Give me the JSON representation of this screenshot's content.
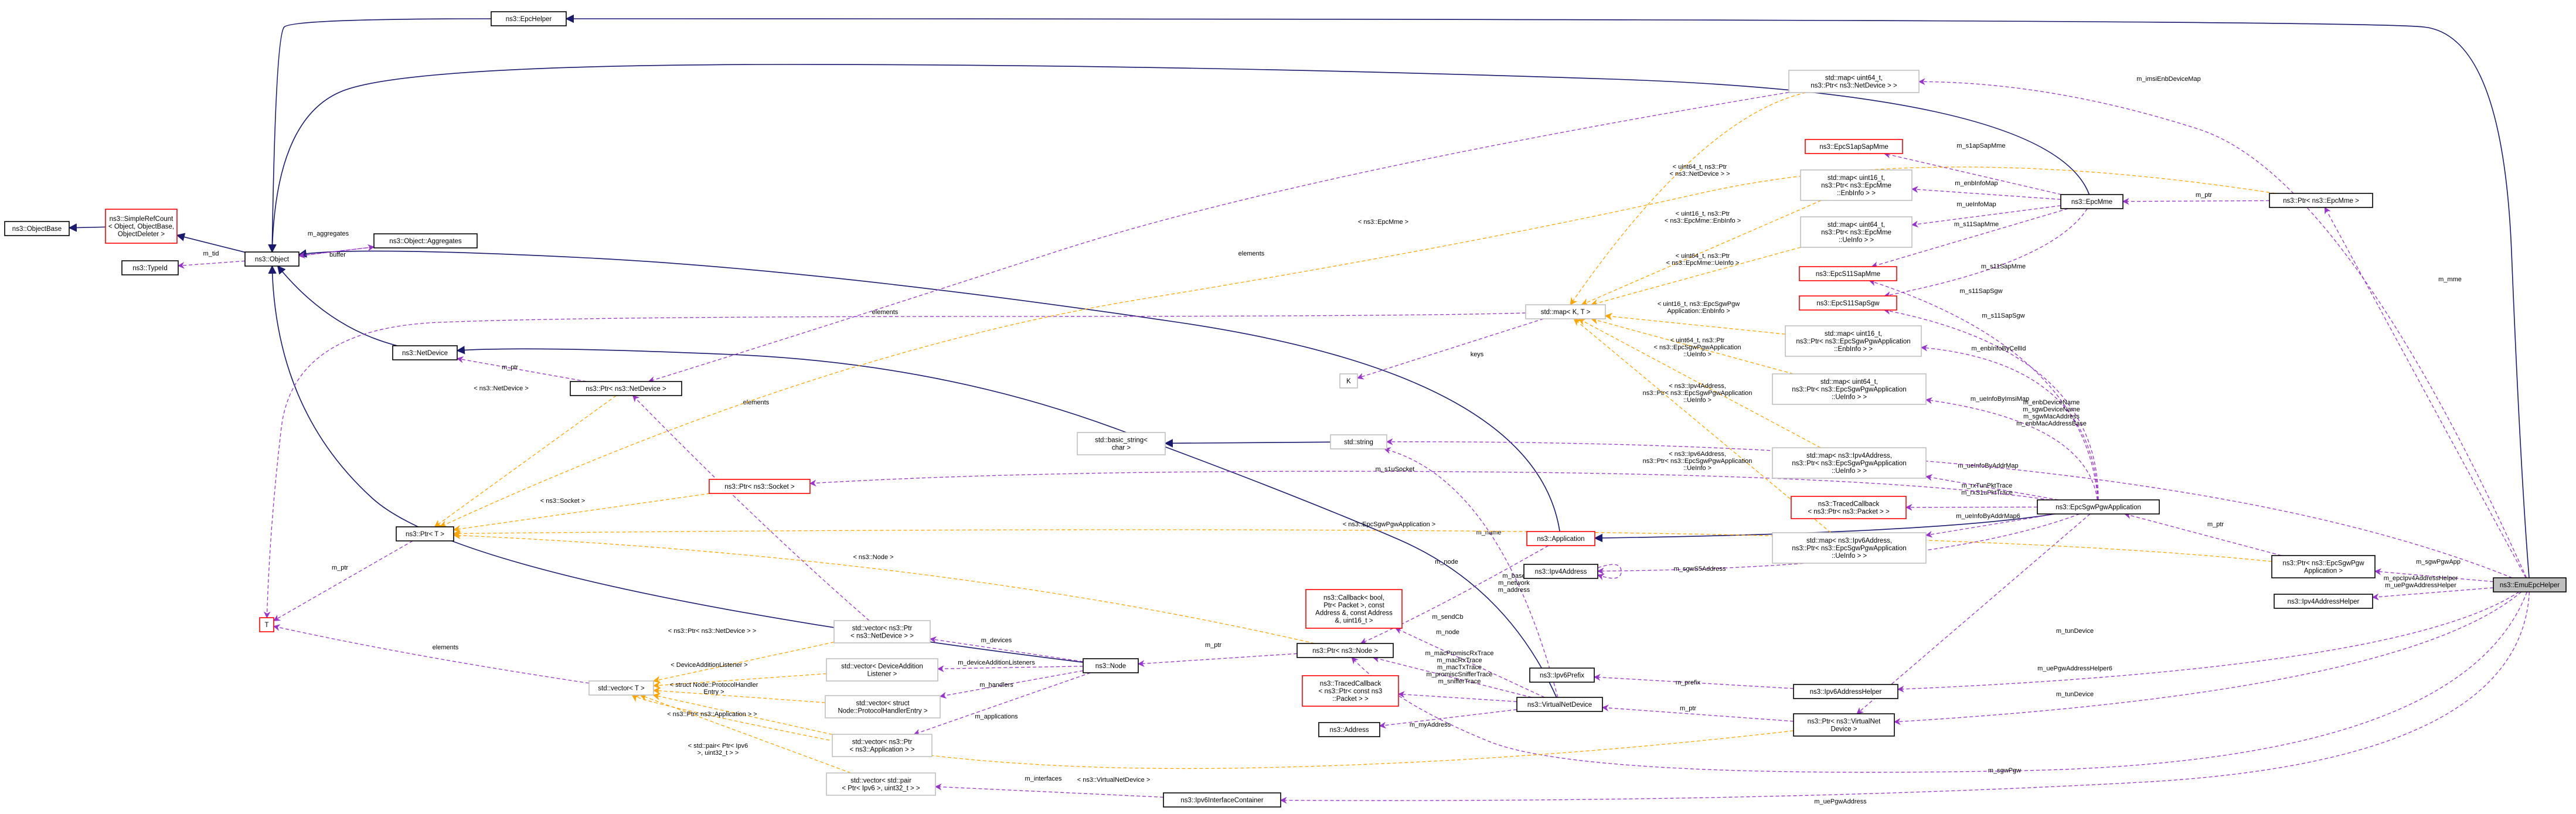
{
  "colors": {
    "inherit": "#191970",
    "use": "#9a32cd",
    "template": "#ffa500",
    "default_border": "#000000",
    "gray_border": "#bfbfbf",
    "red_border": "#ff0000",
    "highlight_fill": "#bfbfbf"
  },
  "nodes": [
    {
      "id": "EpcHelper",
      "lines": [
        "ns3::EpcHelper"
      ],
      "border": "black"
    },
    {
      "id": "ObjectBase",
      "lines": [
        "ns3::ObjectBase"
      ],
      "border": "black"
    },
    {
      "id": "SimpleRefCount",
      "lines": [
        "ns3::SimpleRefCount",
        "< Object, ObjectBase,",
        "ObjectDeleter >"
      ],
      "border": "red"
    },
    {
      "id": "TypeId",
      "lines": [
        "ns3::TypeId"
      ],
      "border": "black"
    },
    {
      "id": "Object",
      "lines": [
        "ns3::Object"
      ],
      "border": "black"
    },
    {
      "id": "ObjectAggregates",
      "lines": [
        "ns3::Object::Aggregates"
      ],
      "border": "black"
    },
    {
      "id": "NetDevice",
      "lines": [
        "ns3::NetDevice"
      ],
      "border": "black"
    },
    {
      "id": "PtrNetDevice",
      "lines": [
        "ns3::Ptr< ns3::NetDevice >"
      ],
      "border": "black"
    },
    {
      "id": "PtrT",
      "lines": [
        "ns3::Ptr< T >"
      ],
      "border": "black"
    },
    {
      "id": "PtrSocket",
      "lines": [
        "ns3::Ptr< ns3::Socket >"
      ],
      "border": "red"
    },
    {
      "id": "T",
      "lines": [
        "T"
      ],
      "border": "red"
    },
    {
      "id": "BasicString",
      "lines": [
        "std::basic_string<",
        "char >"
      ],
      "border": "gray"
    },
    {
      "id": "String",
      "lines": [
        "std::string"
      ],
      "border": "gray"
    },
    {
      "id": "MapNetDevice",
      "lines": [
        "std::map< uint64_t,",
        "ns3::Ptr< ns3::NetDevice > >"
      ],
      "border": "gray"
    },
    {
      "id": "EpcS1apSapMme",
      "lines": [
        "ns3::EpcS1apSapMme"
      ],
      "border": "red"
    },
    {
      "id": "MapEnbInfo",
      "lines": [
        "std::map< uint16_t,",
        "ns3::Ptr< ns3::EpcMme",
        "::EnbInfo > >"
      ],
      "border": "gray"
    },
    {
      "id": "MapUeInfo",
      "lines": [
        "std::map< uint64_t,",
        "ns3::Ptr< ns3::EpcMme",
        "::UeInfo > >"
      ],
      "border": "gray"
    },
    {
      "id": "EpcS11SapMme",
      "lines": [
        "ns3::EpcS11SapMme"
      ],
      "border": "red"
    },
    {
      "id": "EpcS11SapSgw",
      "lines": [
        "ns3::EpcS11SapSgw"
      ],
      "border": "red"
    },
    {
      "id": "StdMapKT",
      "lines": [
        "std::map< K, T >"
      ],
      "border": "gray"
    },
    {
      "id": "K",
      "lines": [
        "K"
      ],
      "border": "gray"
    },
    {
      "id": "MapSgwEnb",
      "lines": [
        "std::map< uint16_t,",
        "ns3::Ptr< ns3::EpcSgwPgwApplication",
        "::EnbInfo > >"
      ],
      "border": "gray"
    },
    {
      "id": "MapSgwUe",
      "lines": [
        "std::map< uint64_t,",
        "ns3::Ptr< ns3::EpcSgwPgwApplication",
        "::UeInfo > >"
      ],
      "border": "gray"
    },
    {
      "id": "MapIpv4Ue",
      "lines": [
        "std::map< ns3::Ipv4Address,",
        "ns3::Ptr< ns3::EpcSgwPgwApplication",
        "::UeInfo > >"
      ],
      "border": "gray"
    },
    {
      "id": "TracedCallbackPacket",
      "lines": [
        "ns3::TracedCallback",
        "< ns3::Ptr< ns3::Packet > >"
      ],
      "border": "red"
    },
    {
      "id": "MapIpv6Ue",
      "lines": [
        "std::map< ns3::Ipv6Address,",
        "ns3::Ptr< ns3::EpcSgwPgwApplication",
        "::UeInfo > >"
      ],
      "border": "gray"
    },
    {
      "id": "EpcMme",
      "lines": [
        "ns3::EpcMme"
      ],
      "border": "black"
    },
    {
      "id": "PtrEpcMme",
      "lines": [
        "ns3::Ptr< ns3::EpcMme >"
      ],
      "border": "black"
    },
    {
      "id": "EpcSgwPgwApplication",
      "lines": [
        "ns3::EpcSgwPgwApplication"
      ],
      "border": "black"
    },
    {
      "id": "Application",
      "lines": [
        "ns3::Application"
      ],
      "border": "red"
    },
    {
      "id": "Ipv4Address",
      "lines": [
        "ns3::Ipv4Address"
      ],
      "border": "black"
    },
    {
      "id": "PtrEpcSgwPgwApp",
      "lines": [
        "ns3::Ptr< ns3::EpcSgwPgw",
        "Application >"
      ],
      "border": "black"
    },
    {
      "id": "Ipv4AddressHelper",
      "lines": [
        "ns3::Ipv4AddressHelper"
      ],
      "border": "black"
    },
    {
      "id": "EmuEpcHelper",
      "lines": [
        "ns3::EmuEpcHelper"
      ],
      "border": "black",
      "highlight": true
    },
    {
      "id": "CallbackBool",
      "lines": [
        "ns3::Callback< bool,",
        "Ptr< Packet >, const",
        "Address &, const Address",
        "&, uint16_t >"
      ],
      "border": "red"
    },
    {
      "id": "PtrNode",
      "lines": [
        "ns3::Ptr< ns3::Node >"
      ],
      "border": "black"
    },
    {
      "id": "TracedCallbackConstPacket",
      "lines": [
        "ns3::TracedCallback",
        "< ns3::Ptr< const ns3",
        "::Packet > >"
      ],
      "border": "red"
    },
    {
      "id": "Address",
      "lines": [
        "ns3::Address"
      ],
      "border": "black"
    },
    {
      "id": "Ipv6Prefix",
      "lines": [
        "ns3::Ipv6Prefix"
      ],
      "border": "black"
    },
    {
      "id": "VirtualNetDevice",
      "lines": [
        "ns3::VirtualNetDevice"
      ],
      "border": "black"
    },
    {
      "id": "Ipv6AddressHelper",
      "lines": [
        "ns3::Ipv6AddressHelper"
      ],
      "border": "black"
    },
    {
      "id": "PtrVirtualNetDevice",
      "lines": [
        "ns3::Ptr< ns3::VirtualNet",
        "Device >"
      ],
      "border": "black"
    },
    {
      "id": "VectorPtrNetDevice",
      "lines": [
        "std::vector< ns3::Ptr",
        "< ns3::NetDevice > >"
      ],
      "border": "gray"
    },
    {
      "id": "VectorListener",
      "lines": [
        "std::vector< DeviceAddition",
        "Listener >"
      ],
      "border": "gray"
    },
    {
      "id": "VectorProtocolHandler",
      "lines": [
        "std::vector< struct",
        "Node::ProtocolHandlerEntry >"
      ],
      "border": "gray"
    },
    {
      "id": "VectorPtrApplication",
      "lines": [
        "std::vector< ns3::Ptr",
        "< ns3::Application > >"
      ],
      "border": "gray"
    },
    {
      "id": "VectorPair",
      "lines": [
        "std::vector< std::pair",
        "< Ptr< Ipv6 >, uint32_t > >"
      ],
      "border": "gray"
    },
    {
      "id": "Node",
      "lines": [
        "ns3::Node"
      ],
      "border": "black"
    },
    {
      "id": "StdVectorT",
      "lines": [
        "std::vector< T >"
      ],
      "border": "gray"
    },
    {
      "id": "Ipv6InterfaceContainer",
      "lines": [
        "ns3::Ipv6InterfaceContainer"
      ],
      "border": "black"
    }
  ],
  "edges": [
    {
      "from": "EpcHelper",
      "to": "Object",
      "kind": "inherit",
      "label": []
    },
    {
      "from": "EmuEpcHelper",
      "to": "EpcHelper",
      "kind": "inherit",
      "label": []
    },
    {
      "from": "SimpleRefCount",
      "to": "ObjectBase",
      "kind": "inherit",
      "label": []
    },
    {
      "from": "Object",
      "to": "SimpleRefCount",
      "kind": "inherit",
      "label": []
    },
    {
      "from": "NetDevice",
      "to": "Object",
      "kind": "inherit",
      "label": []
    },
    {
      "from": "Node",
      "to": "Object",
      "kind": "inherit",
      "label": []
    },
    {
      "from": "Application",
      "to": "Object",
      "kind": "inherit",
      "label": []
    },
    {
      "from": "EpcMme",
      "to": "Object",
      "kind": "inherit",
      "label": []
    },
    {
      "from": "VirtualNetDevice",
      "to": "NetDevice",
      "kind": "inherit",
      "label": []
    },
    {
      "from": "EpcSgwPgwApplication",
      "to": "Application",
      "kind": "inherit",
      "label": []
    },
    {
      "from": "String",
      "to": "BasicString",
      "kind": "inherit",
      "label": []
    },
    {
      "from": "Object",
      "to": "TypeId",
      "kind": "use",
      "label": [
        "m_tid"
      ]
    },
    {
      "from": "Object",
      "to": "ObjectAggregates",
      "kind": "use",
      "label": [
        "m_aggregates"
      ]
    },
    {
      "from": "ObjectAggregates",
      "to": "Object",
      "kind": "use",
      "label": [
        "buffer"
      ]
    },
    {
      "from": "PtrNetDevice",
      "to": "NetDevice",
      "kind": "use",
      "label": [
        "m_ptr"
      ]
    },
    {
      "from": "PtrT",
      "to": "T",
      "kind": "use",
      "label": [
        "m_ptr"
      ]
    },
    {
      "from": "StdMapKT",
      "to": "T",
      "kind": "use",
      "label": [
        "elements"
      ]
    },
    {
      "from": "StdMapKT",
      "to": "K",
      "kind": "use",
      "label": [
        "keys"
      ]
    },
    {
      "from": "StdVectorT",
      "to": "T",
      "kind": "use",
      "label": [
        "elements"
      ]
    },
    {
      "from": "MapNetDevice",
      "to": "PtrNetDevice",
      "kind": "use",
      "label": [
        "elements"
      ]
    },
    {
      "from": "VectorPtrNetDevice",
      "to": "PtrNetDevice",
      "kind": "use",
      "label": [
        "elements"
      ]
    },
    {
      "from": "Node",
      "to": "VectorPtrNetDevice",
      "kind": "use",
      "label": [
        "m_devices"
      ]
    },
    {
      "from": "Node",
      "to": "VectorListener",
      "kind": "use",
      "label": [
        "m_deviceAdditionListeners"
      ]
    },
    {
      "from": "Node",
      "to": "VectorProtocolHandler",
      "kind": "use",
      "label": [
        "m_handlers"
      ]
    },
    {
      "from": "Node",
      "to": "VectorPtrApplication",
      "kind": "use",
      "label": [
        "m_applications"
      ]
    },
    {
      "from": "PtrNode",
      "to": "Node",
      "kind": "use",
      "label": [
        "m_ptr"
      ]
    },
    {
      "from": "Application",
      "to": "PtrNode",
      "kind": "use",
      "label": [
        "m_node"
      ]
    },
    {
      "from": "VirtualNetDevice",
      "to": "PtrNode",
      "kind": "use",
      "label": [
        "m_node"
      ]
    },
    {
      "from": "VirtualNetDevice",
      "to": "CallbackBool",
      "kind": "use",
      "label": [
        "m_sendCb"
      ]
    },
    {
      "from": "VirtualNetDevice",
      "to": "TracedCallbackConstPacket",
      "kind": "use",
      "label": [
        "m_macPromiscRxTrace",
        "m_macRxTrace",
        "m_macTxTrace",
        "m_promiscSnifferTrace",
        "m_snifferTrace"
      ]
    },
    {
      "from": "VirtualNetDevice",
      "to": "Address",
      "kind": "use",
      "label": [
        "m_myAddress"
      ]
    },
    {
      "from": "VirtualNetDevice",
      "to": "String",
      "kind": "use",
      "label": [
        "m_name"
      ]
    },
    {
      "from": "PtrVirtualNetDevice",
      "to": "VirtualNetDevice",
      "kind": "use",
      "label": [
        "m_ptr"
      ]
    },
    {
      "from": "Ipv6AddressHelper",
      "to": "Ipv6Prefix",
      "kind": "use",
      "label": [
        "m_prefix"
      ]
    },
    {
      "from": "Ipv6InterfaceContainer",
      "to": "VectorPair",
      "kind": "use",
      "label": [
        "m_interfaces"
      ]
    },
    {
      "from": "EpcMme",
      "to": "EpcS1apSapMme",
      "kind": "use",
      "label": [
        "m_s1apSapMme"
      ]
    },
    {
      "from": "EpcMme",
      "to": "MapEnbInfo",
      "kind": "use",
      "label": [
        "m_enbInfoMap"
      ]
    },
    {
      "from": "EpcMme",
      "to": "MapUeInfo",
      "kind": "use",
      "label": [
        "m_ueInfoMap"
      ]
    },
    {
      "from": "EpcMme",
      "to": "EpcS11SapMme",
      "kind": "use",
      "label": [
        "m_s11SapMme"
      ]
    },
    {
      "from": "EpcMme",
      "to": "EpcS11SapSgw",
      "kind": "use",
      "label": [
        "m_s11SapSgw"
      ]
    },
    {
      "from": "PtrEpcMme",
      "to": "EpcMme",
      "kind": "use",
      "label": [
        "m_ptr"
      ]
    },
    {
      "from": "EpcSgwPgwApplication",
      "to": "EpcS11SapMme",
      "kind": "use",
      "label": [
        "m_s11SapMme"
      ]
    },
    {
      "from": "EpcSgwPgwApplication",
      "to": "EpcS11SapSgw",
      "kind": "use",
      "label": [
        "m_s11SapSgw"
      ]
    },
    {
      "from": "EpcSgwPgwApplication",
      "to": "MapSgwEnb",
      "kind": "use",
      "label": [
        "m_enbInfoByCellId"
      ]
    },
    {
      "from": "EpcSgwPgwApplication",
      "to": "MapSgwUe",
      "kind": "use",
      "label": [
        "m_ueInfoByImsiMap"
      ]
    },
    {
      "from": "EpcSgwPgwApplication",
      "to": "MapIpv4Ue",
      "kind": "use",
      "label": [
        "m_ueInfoByAddrMap"
      ]
    },
    {
      "from": "EpcSgwPgwApplication",
      "to": "TracedCallbackPacket",
      "kind": "use",
      "label": [
        "m_rxTunPktTrace",
        "m_rxS1uPktTrace"
      ]
    },
    {
      "from": "EpcSgwPgwApplication",
      "to": "MapIpv6Ue",
      "kind": "use",
      "label": [
        "m_ueInfoByAddrMap6"
      ]
    },
    {
      "from": "EpcSgwPgwApplication",
      "to": "PtrSocket",
      "kind": "use",
      "label": [
        "m_s1uSocket"
      ]
    },
    {
      "from": "EpcSgwPgwApplication",
      "to": "Ipv4Address",
      "kind": "use",
      "label": [
        "m_sgwS5Address"
      ]
    },
    {
      "from": "EpcSgwPgwApplication",
      "to": "PtrVirtualNetDevice",
      "kind": "use",
      "label": [
        "m_tunDevice"
      ]
    },
    {
      "from": "PtrEpcSgwPgwApp",
      "to": "EpcSgwPgwApplication",
      "kind": "use",
      "label": [
        "m_ptr"
      ]
    },
    {
      "from": "EmuEpcHelper",
      "to": "MapNetDevice",
      "kind": "use",
      "label": [
        "m_imsiEnbDeviceMap"
      ]
    },
    {
      "from": "EmuEpcHelper",
      "to": "PtrEpcMme",
      "kind": "use",
      "label": [
        "m_mme"
      ]
    },
    {
      "from": "EmuEpcHelper",
      "to": "String",
      "kind": "use",
      "label": [
        "m_enbDeviceName",
        "m_sgwDeviceName",
        "m_sgwMacAddress",
        "m_enbMacAddressBase"
      ]
    },
    {
      "from": "EmuEpcHelper",
      "to": "PtrEpcSgwPgwApp",
      "kind": "use",
      "label": [
        "m_sgwPgwApp"
      ]
    },
    {
      "from": "EmuEpcHelper",
      "to": "Ipv4AddressHelper",
      "kind": "use",
      "label": [
        "m_epcIpv4AddressHelper",
        "m_uePgwAddressHelper"
      ]
    },
    {
      "from": "EmuEpcHelper",
      "to": "Ipv6AddressHelper",
      "kind": "use",
      "label": [
        "m_uePgwAddressHelper6"
      ]
    },
    {
      "from": "EmuEpcHelper",
      "to": "PtrVirtualNetDevice",
      "kind": "use",
      "label": [
        "m_tunDevice"
      ]
    },
    {
      "from": "EmuEpcHelper",
      "to": "PtrNode",
      "kind": "use",
      "label": [
        "m_sgwPgw"
      ]
    },
    {
      "from": "EmuEpcHelper",
      "to": "Ipv6InterfaceContainer",
      "kind": "use",
      "label": [
        "m_uePgwAddress"
      ]
    },
    {
      "from": "Ipv4Address",
      "to": "Ipv4Address",
      "kind": "use",
      "label": [
        "m_base",
        "m_network",
        "m_address"
      ]
    },
    {
      "from": "MapNetDevice",
      "to": "StdMapKT",
      "kind": "template",
      "label": [
        "< uint64_t, ns3::Ptr",
        "< ns3::NetDevice > >"
      ]
    },
    {
      "from": "MapEnbInfo",
      "to": "StdMapKT",
      "kind": "template",
      "label": [
        "< uint16_t, ns3::Ptr",
        "< ns3::EpcMme::EnbInfo >"
      ]
    },
    {
      "from": "MapUeInfo",
      "to": "StdMapKT",
      "kind": "template",
      "label": [
        "< uint64_t, ns3::Ptr",
        "< ns3::EpcMme::UeInfo >"
      ]
    },
    {
      "from": "MapSgwEnb",
      "to": "StdMapKT",
      "kind": "template",
      "label": [
        "< uint16_t, ns3::EpcSgwPgw",
        "Application::EnbInfo >"
      ]
    },
    {
      "from": "MapSgwUe",
      "to": "StdMapKT",
      "kind": "template",
      "label": [
        "< uint64_t, ns3::Ptr",
        "< ns3::EpcSgwPgwApplication",
        "::UeInfo >"
      ]
    },
    {
      "from": "MapIpv4Ue",
      "to": "StdMapKT",
      "kind": "template",
      "label": [
        "< ns3::Ipv4Address,",
        "ns3::Ptr< ns3::EpcSgwPgwApplication",
        "::UeInfo >"
      ]
    },
    {
      "from": "MapIpv6Ue",
      "to": "StdMapKT",
      "kind": "template",
      "label": [
        "< ns3::Ipv6Address,",
        "ns3::Ptr< ns3::EpcSgwPgwApplication",
        "::UeInfo >"
      ]
    },
    {
      "from": "PtrEpcMme",
      "to": "PtrT",
      "kind": "template",
      "label": [
        "< ns3::EpcMme >"
      ]
    },
    {
      "from": "PtrNetDevice",
      "to": "PtrT",
      "kind": "template",
      "label": [
        "< ns3::NetDevice >"
      ]
    },
    {
      "from": "PtrSocket",
      "to": "PtrT",
      "kind": "template",
      "label": [
        "< ns3::Socket >"
      ]
    },
    {
      "from": "PtrEpcSgwPgwApp",
      "to": "PtrT",
      "kind": "template",
      "label": [
        "< ns3::EpcSgwPgwApplication >"
      ]
    },
    {
      "from": "PtrNode",
      "to": "PtrT",
      "kind": "template",
      "label": [
        "< ns3::Node >"
      ]
    },
    {
      "from": "PtrVirtualNetDevice",
      "to": "StdVectorT",
      "kind": "template",
      "label": [
        "< ns3::VirtualNetDevice >"
      ]
    },
    {
      "from": "VectorPtrNetDevice",
      "to": "StdVectorT",
      "kind": "template",
      "label": [
        "< ns3::Ptr< ns3::NetDevice > >"
      ]
    },
    {
      "from": "VectorListener",
      "to": "StdVectorT",
      "kind": "template",
      "label": [
        "< DeviceAdditionListener >"
      ]
    },
    {
      "from": "VectorProtocolHandler",
      "to": "StdVectorT",
      "kind": "template",
      "label": [
        "< struct Node::ProtocolHandler",
        "Entry >"
      ]
    },
    {
      "from": "VectorPtrApplication",
      "to": "StdVectorT",
      "kind": "template",
      "label": [
        "< ns3::Ptr< ns3::Application > >"
      ]
    },
    {
      "from": "VectorPair",
      "to": "StdVectorT",
      "kind": "template",
      "label": [
        "< std::pair< Ptr< Ipv6",
        ">, uint32_t > >"
      ]
    }
  ]
}
